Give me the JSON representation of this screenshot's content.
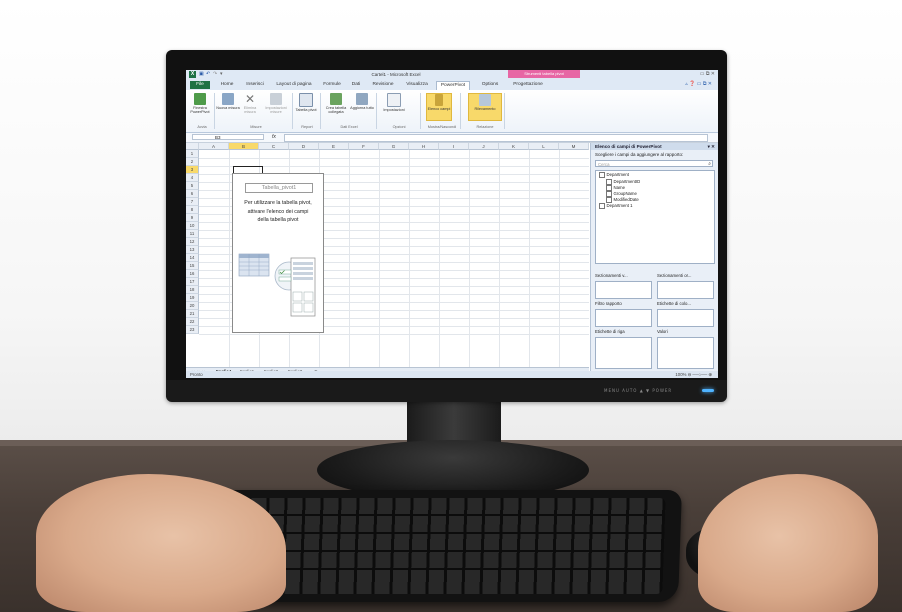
{
  "window": {
    "title": "Cartel1 - Microsoft Excel",
    "context_tab": "Strumenti tabella pivot",
    "controls": "▭ ⧉ ✕"
  },
  "ribbon_tabs": [
    {
      "label": "File"
    },
    {
      "label": "Home"
    },
    {
      "label": "Inserisci"
    },
    {
      "label": "Layout di pagina"
    },
    {
      "label": "Formule"
    },
    {
      "label": "Dati"
    },
    {
      "label": "Revisione"
    },
    {
      "label": "Visualizza"
    },
    {
      "label": "PowerPivot"
    },
    {
      "label": "Options"
    },
    {
      "label": "Progettazione"
    }
  ],
  "ribbon_buttons": {
    "finestra_powerpivot": "Finestra PowerPivot",
    "nuova_misura": "Nuova misura",
    "elimina_misura": "Elimina misura",
    "impostazioni_misure": "Impostazioni misure",
    "tabella_pivot": "Tabella pivot",
    "crea_tabella_collegata": "Crea tabella collegata",
    "aggiorna_tutto": "Aggiorna tutto",
    "impostazioni": "Impostazioni",
    "elenco_campi": "Elenco campi",
    "rilevamento": "Rilevamento"
  },
  "ribbon_groups": {
    "avvia": "Avvia",
    "misure": "Misure",
    "report": "Report",
    "dati_excel": "Dati Excel",
    "opzioni": "Opzioni",
    "mostra_nascondi": "Mostra/Nascondi",
    "relazione": "Relazione"
  },
  "formula_bar": {
    "name_box": "B3",
    "fx": "fx",
    "value": ""
  },
  "columns": [
    "A",
    "B",
    "C",
    "D",
    "E",
    "F",
    "G",
    "H",
    "I",
    "J",
    "K",
    "L",
    "M"
  ],
  "rows": [
    "1",
    "2",
    "3",
    "4",
    "5",
    "6",
    "7",
    "8",
    "9",
    "10",
    "11",
    "12",
    "13",
    "14",
    "15",
    "16",
    "17",
    "18",
    "19",
    "20",
    "21",
    "22",
    "23"
  ],
  "pivot_placeholder": {
    "title": "Tabella_pivot1",
    "message_1": "Per utilizzare la tabella pivot,",
    "message_2": "attivare l'elenco dei campi",
    "message_3": "della tabella pivot"
  },
  "sheet_tabs": [
    {
      "label": "Foglio4"
    },
    {
      "label": "Foglio1"
    },
    {
      "label": "Foglio2"
    },
    {
      "label": "Foglio3"
    }
  ],
  "status": {
    "mode": "Pronto",
    "zoom": "100%"
  },
  "field_list": {
    "title": "Elenco di campi di PowerPivot",
    "prompt": "Scegliere i campi da aggiungere al rapporto:",
    "search_placeholder": "Cerca",
    "table_name": "Department",
    "fields": [
      "DepartmentID",
      "Name",
      "GroupName",
      "ModifiedDate"
    ],
    "other_table": "Department 1",
    "areas": {
      "slicers_v": "Sezionamenti v...",
      "slicers_o": "Sezionamenti or...",
      "report_filter": "Filtro rapporto",
      "column_labels": "Etichette di colo...",
      "row_labels": "Etichette di riga",
      "values": "Valori"
    }
  },
  "monitor": {
    "buttons": "MENU  AUTO  ▲  ▼  POWER"
  },
  "colors": {
    "excel_green": "#1f7244",
    "pivot_context": "#e766a4",
    "selection": "#f8d96a",
    "desk": "#4a3f39"
  }
}
